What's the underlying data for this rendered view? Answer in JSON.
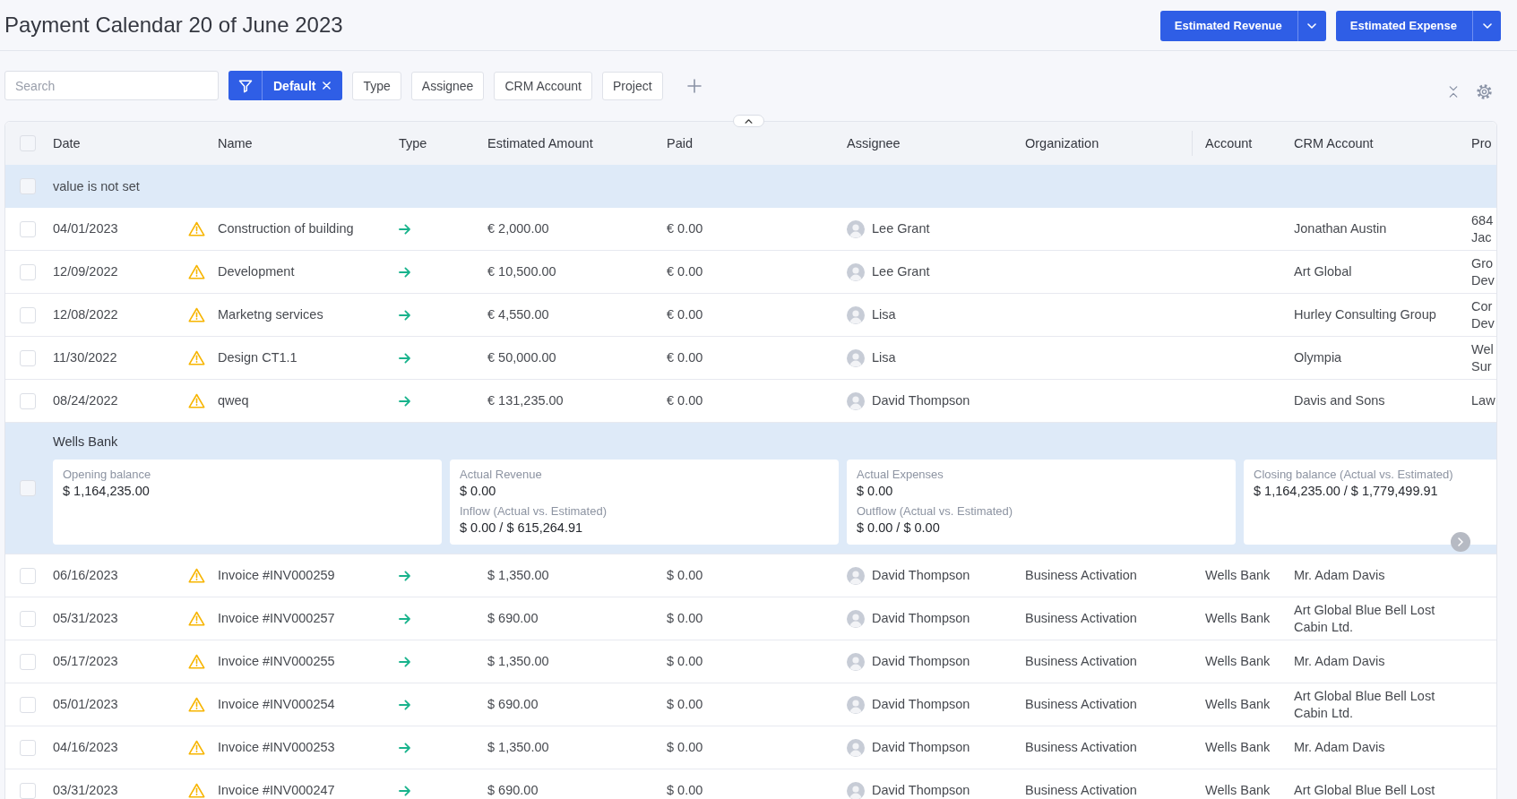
{
  "page": {
    "title": "Payment Calendar 20 of June 2023"
  },
  "actions": [
    {
      "label": "Estimated Revenue"
    },
    {
      "label": "Estimated Expense"
    }
  ],
  "filters": {
    "search": {
      "placeholder": "Search"
    },
    "preset": {
      "label": "Default"
    },
    "chips": [
      {
        "label": "Type"
      },
      {
        "label": "Assignee"
      },
      {
        "label": "CRM Account"
      },
      {
        "label": "Project"
      }
    ]
  },
  "table": {
    "header_checked": false,
    "columns": [
      {
        "label": "Date"
      },
      {
        "label": "Name"
      },
      {
        "label": "Type"
      },
      {
        "label": "Estimated Amount"
      },
      {
        "label": "Paid"
      },
      {
        "label": "Assignee"
      },
      {
        "label": "Organization"
      },
      {
        "label": "Account"
      },
      {
        "label": "CRM Account"
      },
      {
        "label": "Pro"
      }
    ],
    "groups": [
      {
        "kind": "plain",
        "title": "value is not set",
        "checked": false,
        "rows": [
          {
            "checked": false,
            "date": "04/01/2023",
            "name": "Construction of building",
            "estimated_amount": "€ 2,000.00",
            "paid": "€ 0.00",
            "assignee": "Lee Grant",
            "crm_account": "Jonathan Austin",
            "column_10": "684 Jac"
          },
          {
            "checked": false,
            "date": "12/09/2022",
            "name": "Development",
            "estimated_amount": "€ 10,500.00",
            "paid": "€ 0.00",
            "assignee": "Lee Grant",
            "crm_account": "Art Global",
            "column_10": "Gro Dev"
          },
          {
            "checked": false,
            "date": "12/08/2022",
            "name": "Marketng services",
            "estimated_amount": "€ 4,550.00",
            "paid": "€ 0.00",
            "assignee": "Lisa",
            "crm_account": "Hurley Consulting Group",
            "column_10": "Cor Dev"
          },
          {
            "checked": false,
            "date": "11/30/2022",
            "name": "Design CT1.1",
            "estimated_amount": "€ 50,000.00",
            "paid": "€ 0.00",
            "assignee": "Lisa",
            "crm_account": "Olympia",
            "column_10": "Wel Sur"
          },
          {
            "checked": false,
            "date": "08/24/2022",
            "name": "qweq",
            "estimated_amount": "€ 131,235.00",
            "paid": "€ 0.00",
            "assignee": "David Thompson",
            "crm_account": "Davis and Sons",
            "column_10": "Law"
          }
        ]
      },
      {
        "kind": "summary",
        "title": "Wells Bank",
        "checked": false,
        "summary": [
          {
            "label": "Opening balance",
            "value": "$ 1,164,235.00"
          },
          {
            "label": "Actual Revenue",
            "value": "$ 0.00",
            "sub_label": "Inflow (Actual vs. Estimated)",
            "sub_value": "$ 0.00 / $ 615,264.91"
          },
          {
            "label": "Actual Expenses",
            "value": "$ 0.00",
            "sub_label": "Outflow (Actual vs. Estimated)",
            "sub_value": "$ 0.00 / $ 0.00"
          },
          {
            "label": "Closing balance (Actual vs. Estimated)",
            "value": "$ 1,164,235.00 / $ 1,779,499.91"
          }
        ],
        "rows": [
          {
            "checked": false,
            "date": "06/16/2023",
            "name": "Invoice #INV000259",
            "estimated_amount": "$ 1,350.00",
            "paid": "$ 0.00",
            "assignee": "David Thompson",
            "organization": "Business Activation",
            "account": "Wells Bank",
            "crm_account": "Mr. Adam Davis"
          },
          {
            "checked": false,
            "date": "05/31/2023",
            "name": "Invoice #INV000257",
            "estimated_amount": "$ 690.00",
            "paid": "$ 0.00",
            "assignee": "David Thompson",
            "organization": "Business Activation",
            "account": "Wells Bank",
            "crm_account": "Art Global Blue Bell Lost Cabin Ltd."
          },
          {
            "checked": false,
            "date": "05/17/2023",
            "name": "Invoice #INV000255",
            "estimated_amount": "$ 1,350.00",
            "paid": "$ 0.00",
            "assignee": "David Thompson",
            "organization": "Business Activation",
            "account": "Wells Bank",
            "crm_account": "Mr. Adam Davis"
          },
          {
            "checked": false,
            "date": "05/01/2023",
            "name": "Invoice #INV000254",
            "estimated_amount": "$ 690.00",
            "paid": "$ 0.00",
            "assignee": "David Thompson",
            "organization": "Business Activation",
            "account": "Wells Bank",
            "crm_account": "Art Global Blue Bell Lost Cabin Ltd."
          },
          {
            "checked": false,
            "date": "04/16/2023",
            "name": "Invoice #INV000253",
            "estimated_amount": "$ 1,350.00",
            "paid": "$ 0.00",
            "assignee": "David Thompson",
            "organization": "Business Activation",
            "account": "Wells Bank",
            "crm_account": "Mr. Adam Davis"
          },
          {
            "checked": false,
            "date": "03/31/2023",
            "name": "Invoice #INV000247",
            "estimated_amount": "$ 690.00",
            "paid": "$ 0.00",
            "assignee": "David Thompson",
            "organization": "Business Activation",
            "account": "Wells Bank",
            "crm_account": "Art Global Blue Bell Lost"
          }
        ]
      }
    ]
  }
}
